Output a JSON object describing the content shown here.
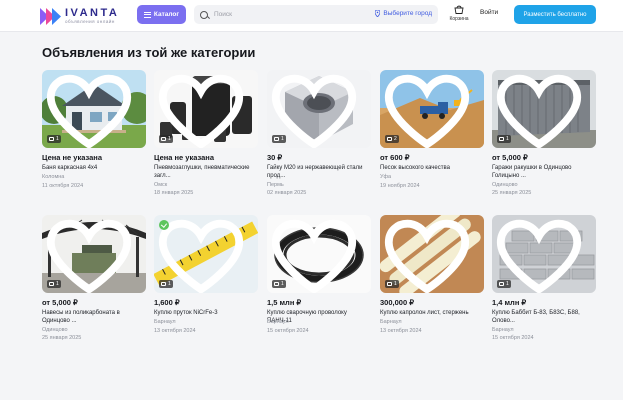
{
  "header": {
    "logo_title": "IVANTA",
    "logo_subtitle": "объявления онлайн",
    "catalog_label": "Каталог",
    "search_placeholder": "Поиск",
    "city_label": "Выберите город",
    "cart_label": "Корзина",
    "login_label": "Войти",
    "post_label": "Разместить бесплатно"
  },
  "colors": {
    "accent_purple": "#7b6ff0",
    "accent_blue": "#1fa3e8",
    "link_blue": "#3f5be0",
    "verified_green": "#5ec55e"
  },
  "section": {
    "title": "Объявления из той же категории"
  },
  "cards": [
    {
      "price": "Цена не указана",
      "title": "Баня каркасная 4x4",
      "city": "Коломна",
      "date": "11 октября 2024",
      "photos": "1",
      "verified": false,
      "image": "sauna-house"
    },
    {
      "price": "Цена не указана",
      "title": "Пневмозаглушки, пневматические загл...",
      "city": "Омск",
      "date": "18 января 2025",
      "photos": "1",
      "verified": false,
      "image": "pneumatic-plugs"
    },
    {
      "price": "30 ₽",
      "title": "Гайку М20 из нержавеющей стали прод...",
      "city": "Пермь",
      "date": "02 января 2025",
      "photos": "1",
      "verified": false,
      "image": "hex-nut"
    },
    {
      "price": "от 600 ₽",
      "title": "Песок высокого качества",
      "city": "Уфа",
      "date": "19 ноября 2024",
      "photos": "2",
      "verified": false,
      "image": "sand-quarry"
    },
    {
      "price": "от 5,000 ₽",
      "title": "Гаражи ракушки в Одинцово Голицыно ...",
      "city": "Одинцово",
      "date": "25 января 2025",
      "photos": "1",
      "verified": false,
      "image": "garage"
    },
    {
      "price": "от 5,000 ₽",
      "title": "Навесы из поликарбоната в Одинцово ...",
      "city": "Одинцово",
      "date": "25 января 2025",
      "photos": "1",
      "verified": false,
      "image": "carport"
    },
    {
      "price": "1,600 ₽",
      "title": "Куплю пруток NiCrFe-3",
      "city": "Барнаул",
      "date": "13 октября 2024",
      "photos": "1",
      "verified": true,
      "image": "tape-measure"
    },
    {
      "price": "1,5 млн ₽",
      "title": "Куплю сварочную проволоку ПАНЧ-11",
      "city": "Барнаул",
      "date": "15 октября 2024",
      "photos": "1",
      "verified": false,
      "image": "wire-coil"
    },
    {
      "price": "300,000 ₽",
      "title": "Куплю капролон лист, стержень",
      "city": "Барнаул",
      "date": "13 октября 2024",
      "photos": "1",
      "verified": false,
      "image": "rods"
    },
    {
      "price": "1,4 млн ₽",
      "title": "Куплю Баббит Б-83, Б83С, Б88, Олово...",
      "city": "Барнаул",
      "date": "15 октября 2024",
      "photos": "1",
      "verified": false,
      "image": "ingots"
    }
  ]
}
